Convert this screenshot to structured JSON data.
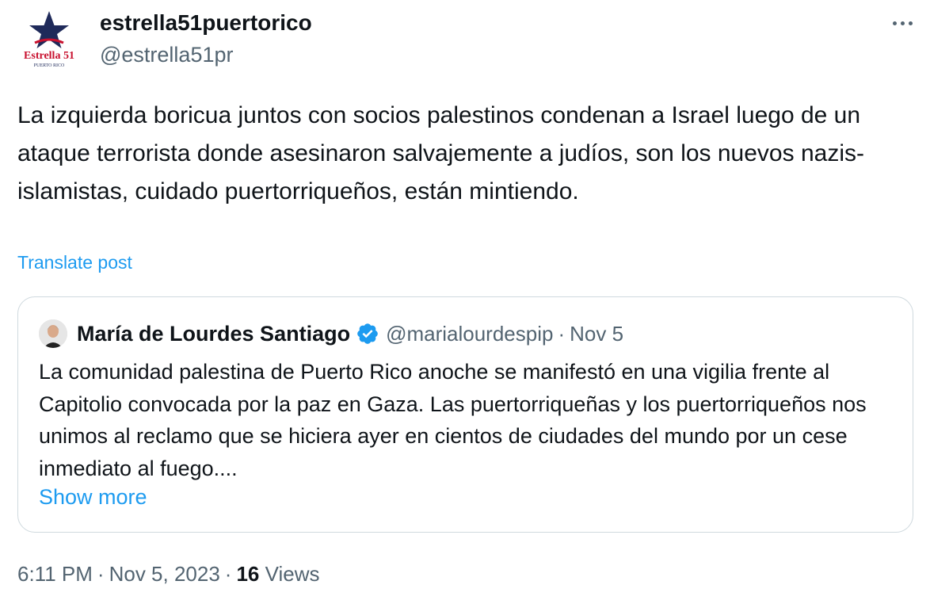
{
  "author": {
    "display_name": "estrella51puertorico",
    "handle": "@estrella51pr",
    "avatar_logo_text": "Estrella 51",
    "avatar_logo_subtext": "PUERTO RICO"
  },
  "tweet": {
    "text": "La izquierda boricua juntos con socios palestinos condenan a Israel luego de un ataque terrorista donde asesinaron salvajemente a judíos, son los nuevos nazis-islamistas, cuidado puertorriqueños, están mintiendo.",
    "translate_label": "Translate post"
  },
  "quote": {
    "display_name": "María de Lourdes Santiago",
    "handle": "@marialourdespip",
    "separator": "·",
    "date": "Nov 5",
    "text": "La comunidad palestina de Puerto Rico anoche se manifestó en una vigilia frente al Capitolio convocada por la paz en Gaza. Las puertorriqueñas y los puertorriqueños nos unimos al reclamo que se hiciera ayer en cientos de ciudades del mundo por un cese inmediato al fuego....",
    "show_more_label": "Show more"
  },
  "meta": {
    "time": "6:11 PM",
    "separator": "·",
    "date": "Nov 5, 2023",
    "views_count": "16",
    "views_label": "Views"
  },
  "colors": {
    "accent": "#1d9bf0",
    "secondary_text": "#536471",
    "border": "#cfd9de",
    "logo_red": "#c8102e",
    "logo_navy": "#1f2a5a"
  }
}
